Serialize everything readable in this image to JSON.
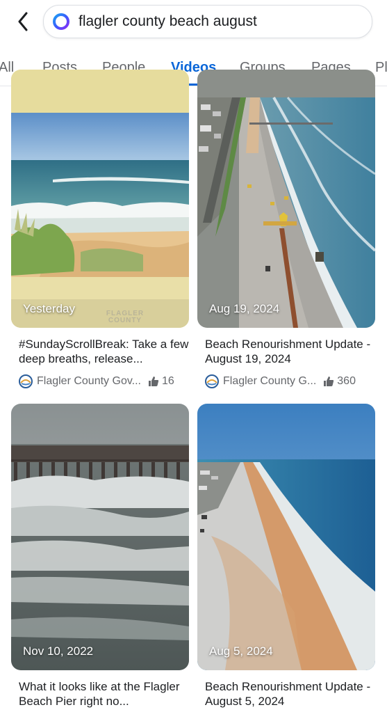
{
  "search": {
    "query": "flagler county beach august"
  },
  "tabs": [
    {
      "label": "All"
    },
    {
      "label": "Posts"
    },
    {
      "label": "People"
    },
    {
      "label": "Videos",
      "active": true
    },
    {
      "label": "Groups"
    },
    {
      "label": "Pages"
    },
    {
      "label": "Pl"
    }
  ],
  "colors": {
    "accent": "#0a66d8",
    "secondary_text": "#65676b"
  },
  "videos": [
    {
      "date": "Yesterday",
      "title": "#SundayScrollBreak: Take a few deep breaths, release...",
      "author": "Flagler County Gov...",
      "likes": "16",
      "watermark": "FLAGLER COUNTY"
    },
    {
      "date": "Aug 19, 2024",
      "title": "Beach Renourishment Update - August 19, 2024",
      "author": "Flagler County G...",
      "likes": "360"
    },
    {
      "date": "Nov 10, 2022",
      "title": "What it looks like at the Flagler Beach Pier right no..."
    },
    {
      "date": "Aug 5, 2024",
      "title": "Beach Renourishment Update - August 5, 2024"
    }
  ]
}
